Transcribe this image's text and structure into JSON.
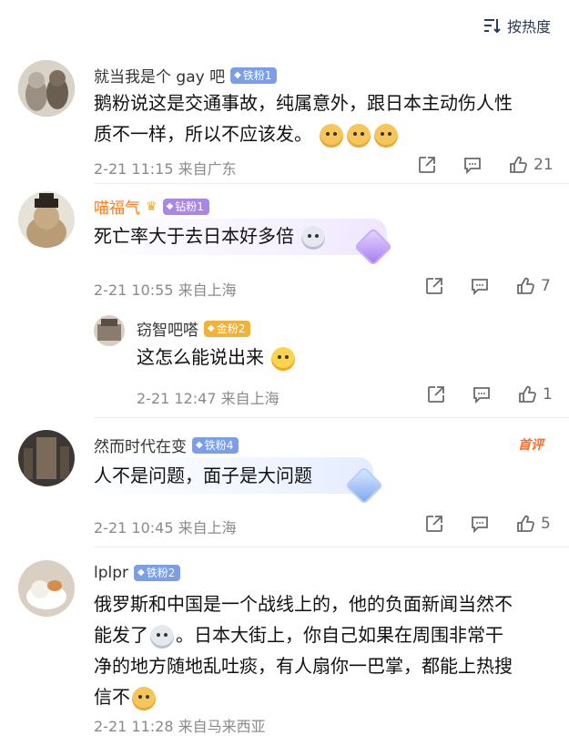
{
  "sort": {
    "label": "按热度"
  },
  "comments": [
    {
      "name": "就当我是个 gay 吧",
      "badge": "铁粉1",
      "text1": "鹅粉说这是交通事故，纯属意外，跟日本主动伤人性",
      "text2": "质不一样，所以不应该发。",
      "time": "2-21 11:15",
      "location": "来自广东",
      "likes": "21"
    },
    {
      "name": "喵福气",
      "badge": "钻粉1",
      "text1": "死亡率大于去日本好多倍",
      "time": "2-21 10:55",
      "location": "来自上海",
      "likes": "7",
      "reply": {
        "name": "窃智吧嗒",
        "badge": "金粉2",
        "text1": "这怎么能说出来",
        "time": "2-21 12:47",
        "location": "来自上海",
        "likes": "1"
      }
    },
    {
      "name": "然而时代在变",
      "badge": "铁粉4",
      "tag": "首评",
      "text1": "人不是问题，面子是大问题",
      "time": "2-21 10:45",
      "location": "来自上海",
      "likes": "5"
    },
    {
      "name": "lplpr",
      "badge": "铁粉2",
      "text1": "俄罗斯和中国是一个战线上的，他的负面新闻当然不",
      "text2": "能发了",
      "text2b": "。日本大街上，你自己如果在周围非常干",
      "text3": "净的地方随地乱吐痰，有人扇你一巴掌，都能上热搜",
      "text4": "信不",
      "time": "2-21 11:28",
      "location": "来自马来西亚"
    }
  ],
  "colors": {
    "accent": "#7b9ee8",
    "diamond": "#a887e8",
    "gold": "#f0b23b",
    "hot": "#ff6a2b"
  }
}
